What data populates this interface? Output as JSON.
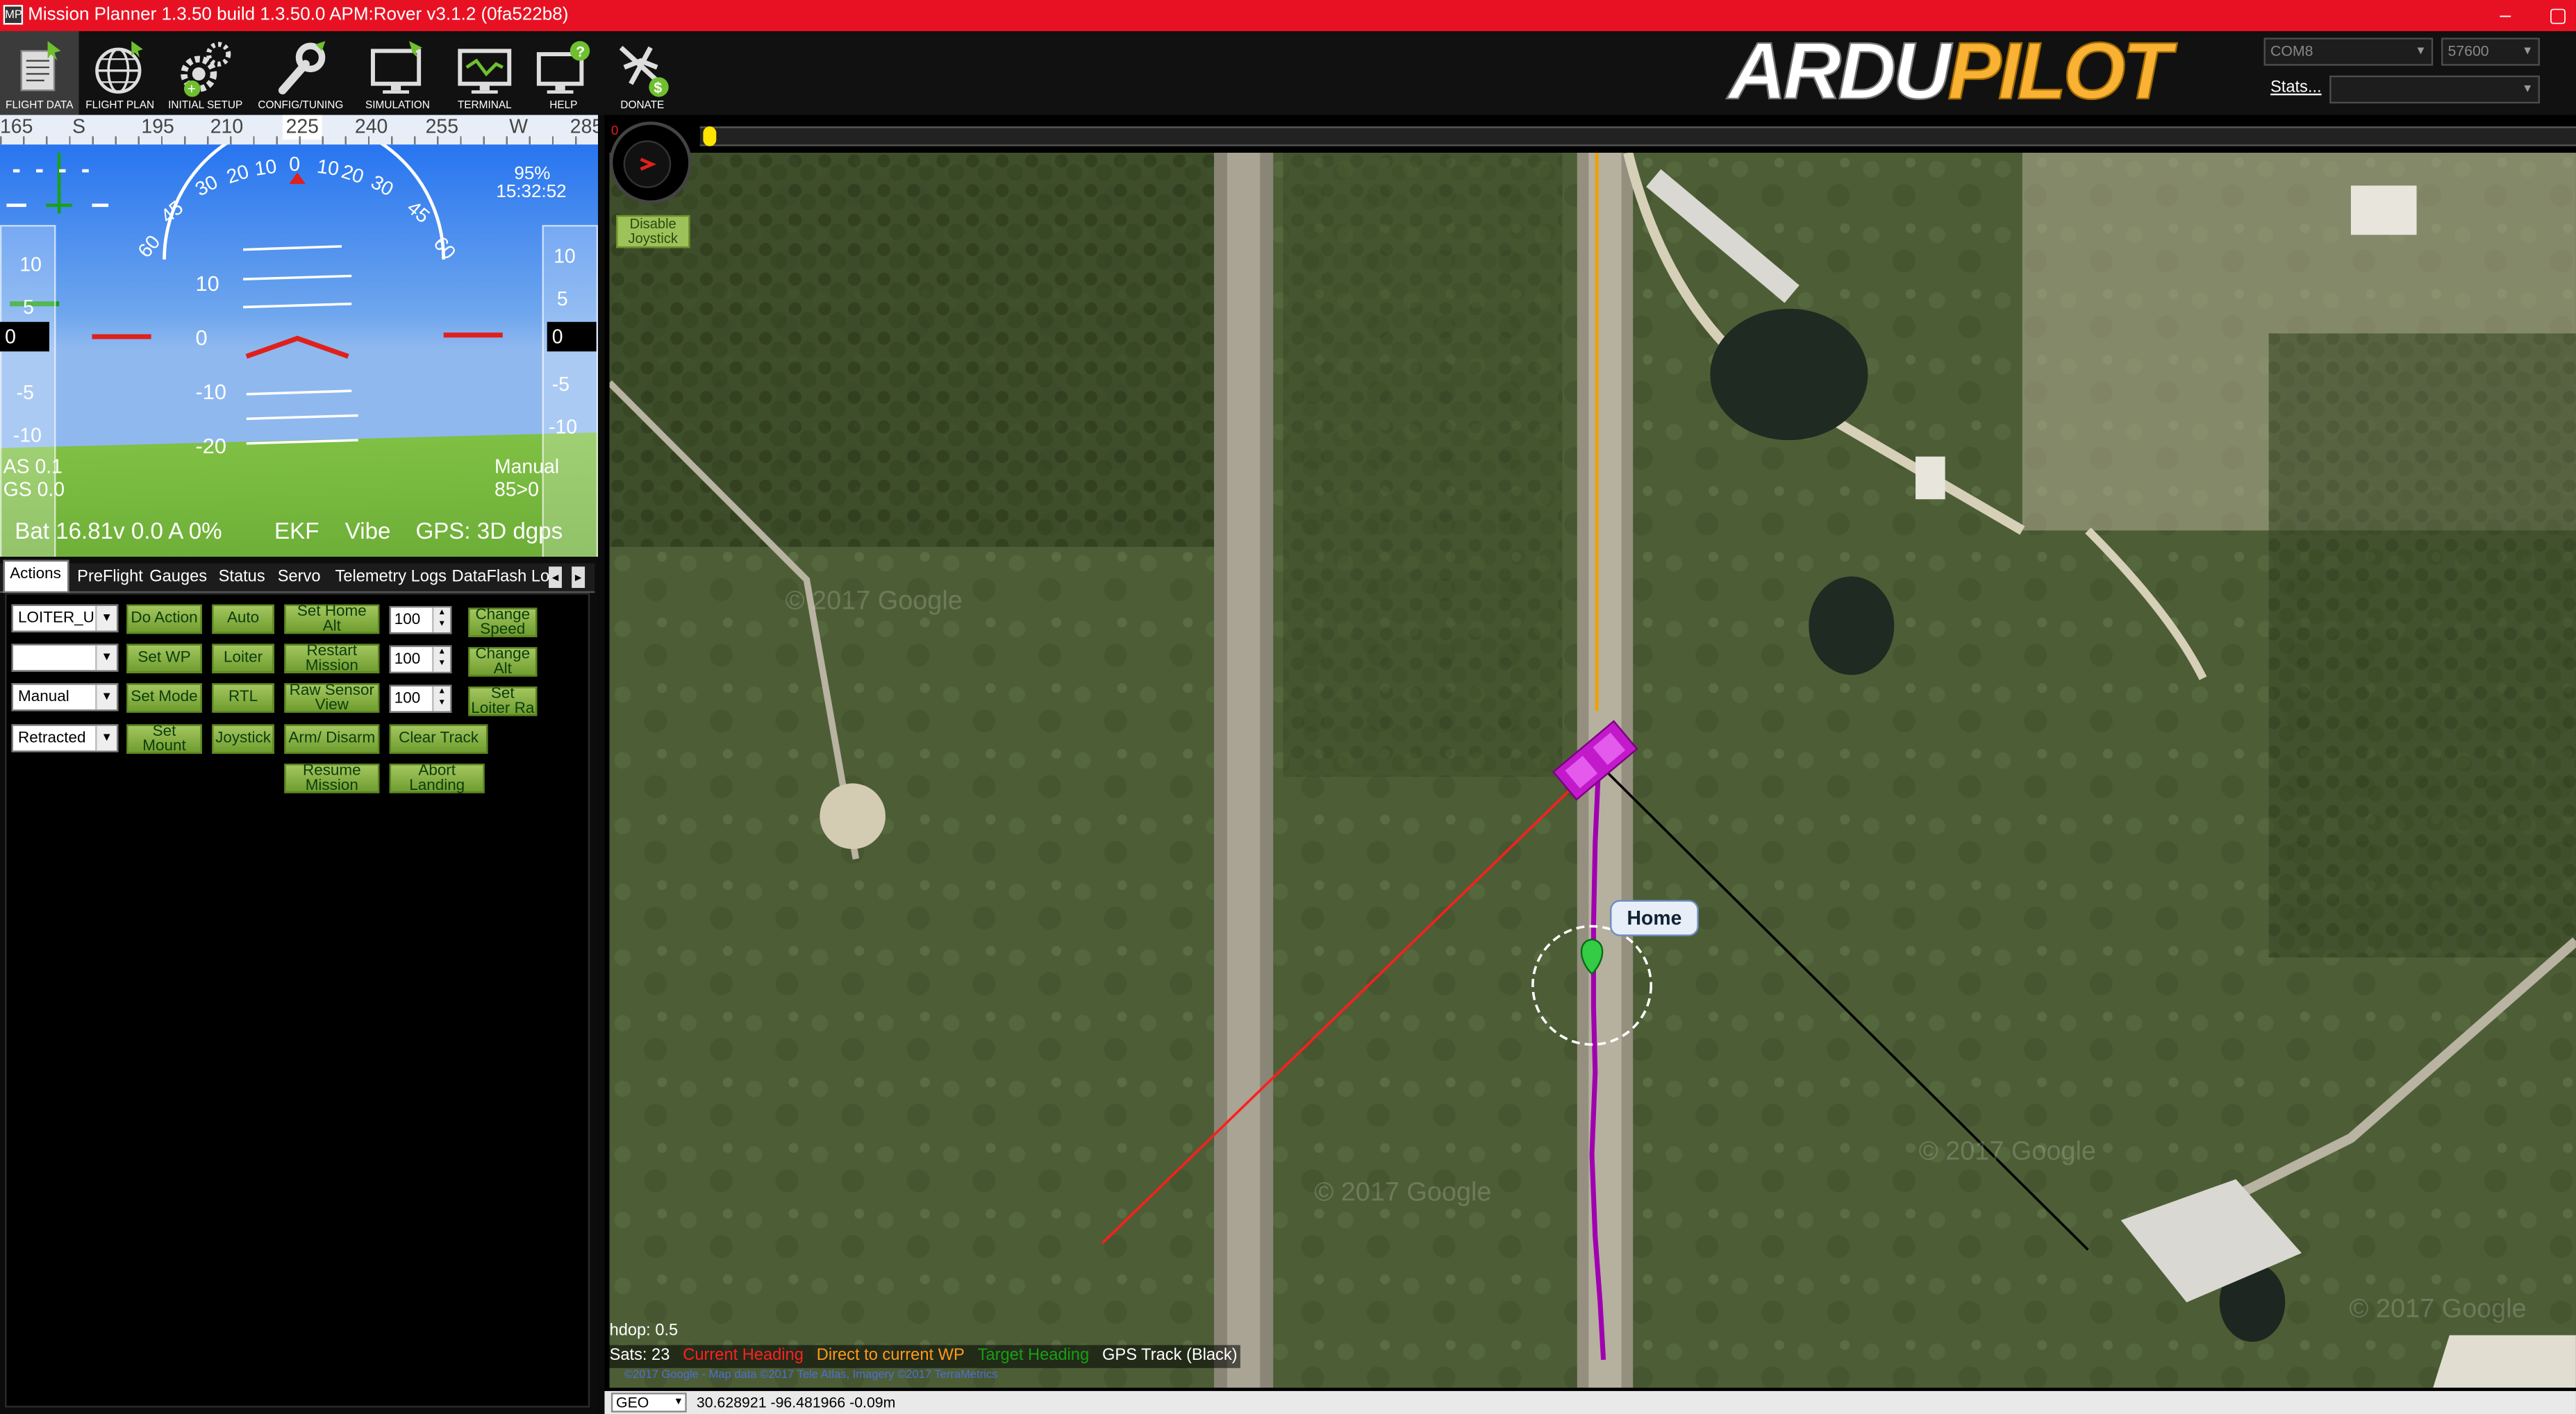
{
  "window": {
    "title": "Mission Planner 1.3.50 build 1.3.50.0 APM:Rover v3.1.2 (0fa522b8)",
    "app_icon_text": "MP",
    "minimize": "–",
    "restore": "▢"
  },
  "toolbar": {
    "items": [
      {
        "label": "FLIGHT DATA",
        "icon": "flight-data-icon"
      },
      {
        "label": "FLIGHT PLAN",
        "icon": "globe-icon"
      },
      {
        "label": "INITIAL SETUP",
        "icon": "gears-icon"
      },
      {
        "label": "CONFIG/TUNING",
        "icon": "wrench-icon"
      },
      {
        "label": "SIMULATION",
        "icon": "monitor-plane-icon"
      },
      {
        "label": "TERMINAL",
        "icon": "terminal-icon"
      },
      {
        "label": "HELP",
        "icon": "help-monitor-icon"
      },
      {
        "label": "DONATE",
        "icon": "plane-dollar-icon"
      }
    ],
    "logo_part1": "ARDU",
    "logo_part2": "PILOT",
    "port": "COM8",
    "baud": "57600",
    "stats_link": "Stats..."
  },
  "hud": {
    "compass_ticks": [
      "165",
      "S",
      "195",
      "210",
      "225",
      "240",
      "255",
      "W",
      "285"
    ],
    "compass_heading": "225",
    "pitch_top_labels": [
      "60",
      "45",
      "30",
      "20",
      "10",
      "0",
      "10",
      "20",
      "30",
      "45",
      "60"
    ],
    "pitch_labels": [
      "10",
      "0",
      "-10",
      "-20"
    ],
    "speed_ticks": [
      "10",
      "5",
      "-5",
      "-10"
    ],
    "alt_ticks": [
      "10",
      "5",
      "-5",
      "-10"
    ],
    "speed_value": "0",
    "alt_value": "0",
    "signal": "95%",
    "time": "15:32:52",
    "airspeed": "AS 0.1",
    "groundspeed": "GS 0.0",
    "mode": "Manual",
    "wp": "85>0",
    "battery": "Bat 16.81v 0.0 A 0%",
    "ekf": "EKF",
    "vibe": "Vibe",
    "gps": "GPS: 3D dgps"
  },
  "tabs": [
    "Actions",
    "PreFlight",
    "Gauges",
    "Status",
    "Servo",
    "Telemetry Logs",
    "DataFlash Log"
  ],
  "tab_scroll": [
    "◂",
    "▸"
  ],
  "actions": {
    "selects": [
      "LOITER_U",
      "",
      "Manual",
      "Retracted"
    ],
    "buttons": {
      "do_action": "Do Action",
      "auto": "Auto",
      "set_home_alt": "Set Home\nAlt",
      "change_speed": "Change\nSpeed",
      "set_wp": "Set WP",
      "loiter": "Loiter",
      "restart_mission": "Restart\nMission",
      "change_alt": "Change\nAlt",
      "set_mode": "Set Mode",
      "rtl": "RTL",
      "raw_sensor_view": "Raw Sensor\nView",
      "set_loiter_rad": "Set\nLoiter Ra",
      "set_mount": "Set\nMount",
      "joystick": "Joystick",
      "arm_disarm": "Arm/ Disarm",
      "clear_track": "Clear Track",
      "resume_mission": "Resume\nMission",
      "abort_landing": "Abort\nLanding"
    },
    "numbers": [
      "100",
      "100",
      "100"
    ]
  },
  "map": {
    "joystick_button": "Disable\nJoystick",
    "home_label": "Home",
    "hdop": "hdop: 0.5",
    "sats": "Sats: 23",
    "legend": [
      {
        "text": "Current Heading",
        "color": "#ff2020"
      },
      {
        "text": "Direct to current WP",
        "color": "#ff9a1a"
      },
      {
        "text": "Target Heading",
        "color": "#15a015"
      },
      {
        "text": "GPS Track (Black)",
        "color": "#ffffff"
      }
    ],
    "copyright": "©2017 Google - Map data ©2017 Tele Atlas, Imagery ©2017 TerraMetrics",
    "watermarks": [
      "© 2017 Google",
      "© 2017 Google",
      "© 2017 Google",
      "© 2017 Google"
    ],
    "coords": "30.628921 -96.481966 -0.09m",
    "map_source": "GEO"
  }
}
